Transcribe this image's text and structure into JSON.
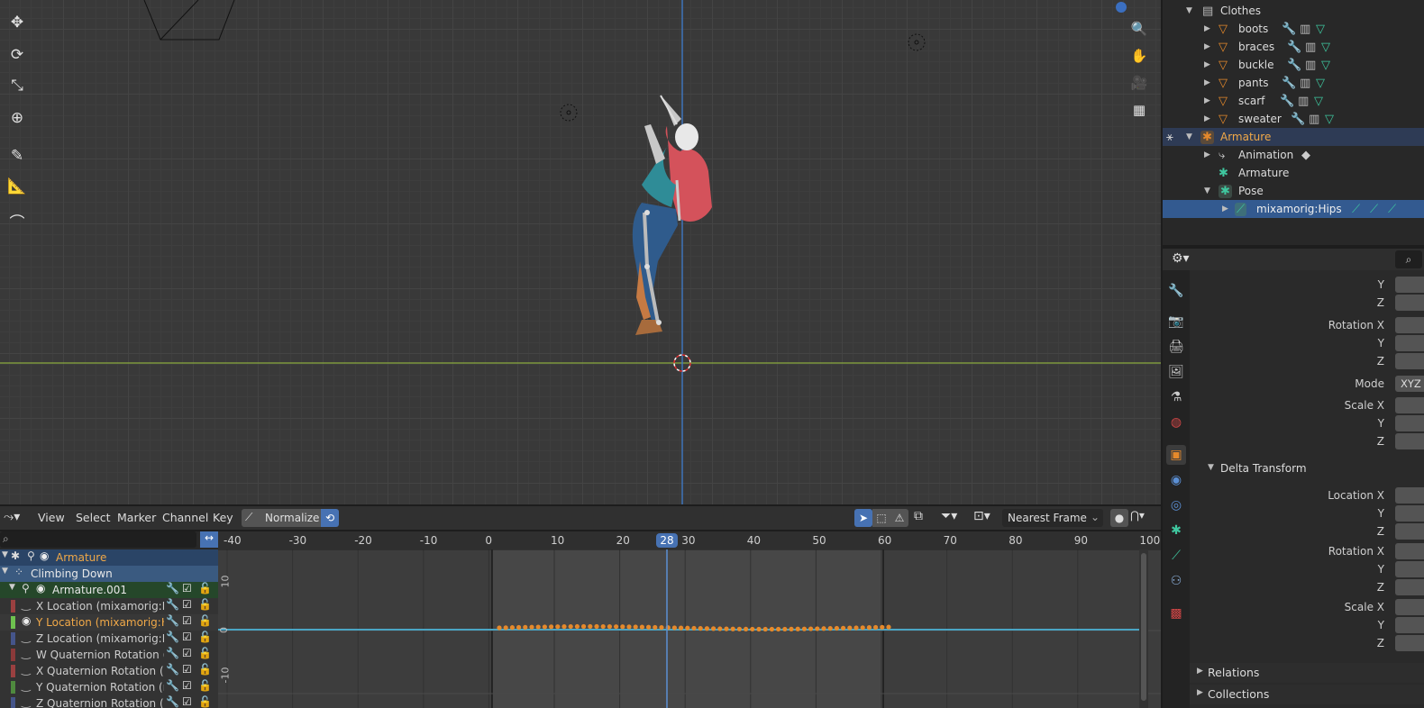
{
  "outliner": {
    "items": [
      {
        "label": "Clothes",
        "indent": 1,
        "icon": "collection-icon"
      },
      {
        "label": "boots",
        "indent": 2,
        "icon": "mesh-icon"
      },
      {
        "label": "braces",
        "indent": 2,
        "icon": "mesh-icon"
      },
      {
        "label": "buckle",
        "indent": 2,
        "icon": "mesh-icon"
      },
      {
        "label": "pants",
        "indent": 2,
        "icon": "mesh-icon"
      },
      {
        "label": "scarf",
        "indent": 2,
        "icon": "mesh-icon"
      },
      {
        "label": "sweater",
        "indent": 2,
        "icon": "mesh-icon"
      },
      {
        "label": "Armature",
        "indent": 1,
        "icon": "armature-icon"
      },
      {
        "label": "Animation",
        "indent": 2,
        "icon": "animation-icon"
      },
      {
        "label": "Armature",
        "indent": 2,
        "icon": "armature-data-icon"
      },
      {
        "label": "Pose",
        "indent": 2,
        "icon": "pose-icon"
      },
      {
        "label": "mixamorig:Hips",
        "indent": 3,
        "icon": "bone-icon"
      }
    ]
  },
  "properties": {
    "labels_top": [
      "Y",
      "Z",
      "Rotation X",
      "Y",
      "Z",
      "Mode",
      "Scale X",
      "Y",
      "Z"
    ],
    "mode_value": "XYZ",
    "delta_transform": "Delta Transform",
    "labels_delta": [
      "Location X",
      "Y",
      "Z",
      "Rotation X",
      "Y",
      "Z",
      "Scale X",
      "Y",
      "Z"
    ],
    "relations": "Relations",
    "collections": "Collections"
  },
  "graph_header": {
    "menus": [
      "View",
      "Select",
      "Marker",
      "Channel",
      "Key"
    ],
    "normalize": "Normalize",
    "snap": "Nearest Frame"
  },
  "channels": {
    "armature": "Armature",
    "action": "Climbing Down",
    "object": "Armature.001",
    "fcurves": [
      "X Location (mixamorig:Hips)",
      "Y Location (mixamorig:Hips)",
      "Z Location (mixamorig:Hips)",
      "W Quaternion Rotation (mixa",
      "X Quaternion Rotation (mixa",
      "Y Quaternion Rotation (mixa",
      "Z Quaternion Rotation (mixa"
    ]
  },
  "timeline": {
    "frame_ticks": [
      "-40",
      "-30",
      "-20",
      "-10",
      "0",
      "10",
      "20",
      "30",
      "40",
      "50",
      "60",
      "70",
      "80",
      "90",
      "100"
    ],
    "current_frame": "28",
    "value_ticks": [
      "10",
      "0",
      "-10"
    ]
  }
}
